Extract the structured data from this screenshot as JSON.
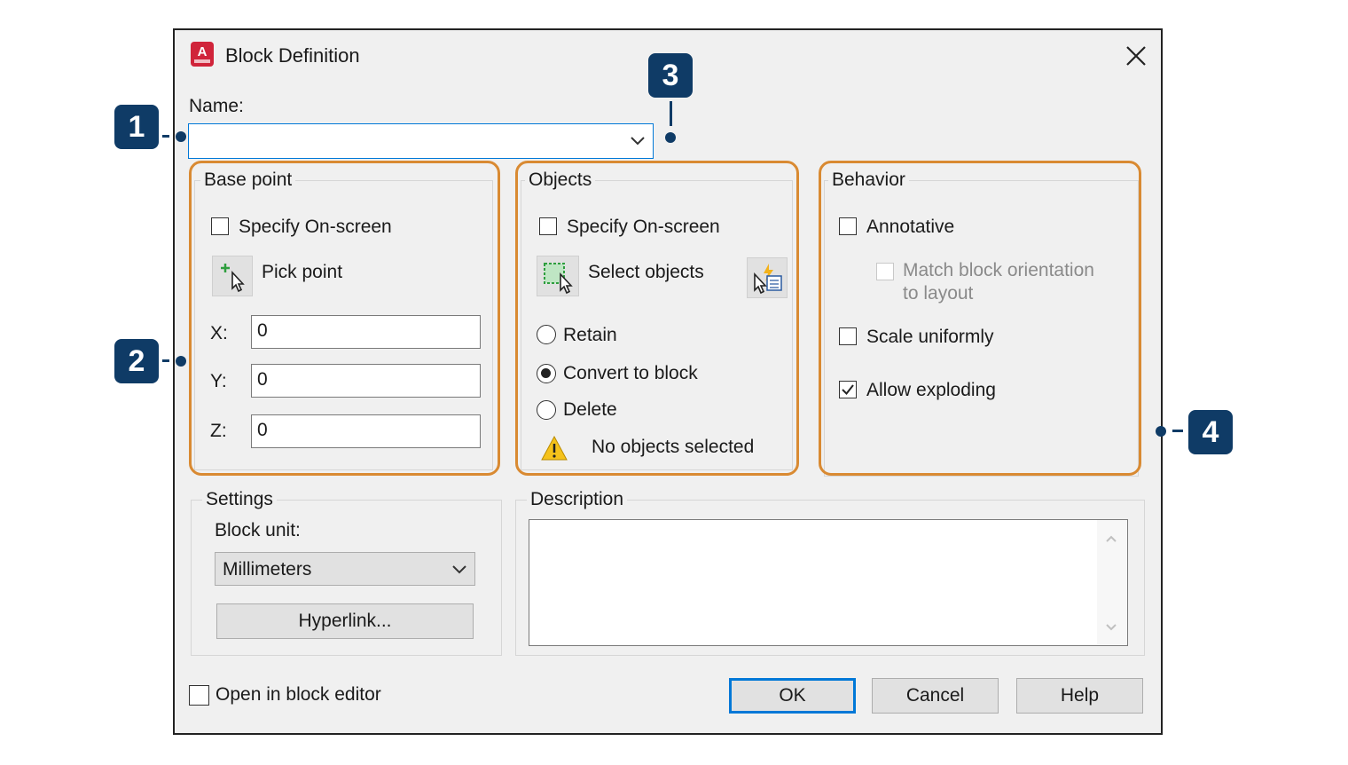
{
  "dialog": {
    "title": "Block Definition",
    "name_label": "Name:",
    "name_value": ""
  },
  "base_point": {
    "title": "Base point",
    "specify_on_screen": "Specify On-screen",
    "pick_point": "Pick point",
    "x_label": "X:",
    "y_label": "Y:",
    "z_label": "Z:",
    "x_value": "0",
    "y_value": "0",
    "z_value": "0"
  },
  "objects": {
    "title": "Objects",
    "specify_on_screen": "Specify On-screen",
    "select_objects": "Select objects",
    "retain": "Retain",
    "convert_to_block": "Convert to block",
    "delete": "Delete",
    "selected_option": "Convert to block",
    "status": "No objects selected"
  },
  "behavior": {
    "title": "Behavior",
    "annotative": "Annotative",
    "match_orientation_line1": "Match block orientation",
    "match_orientation_line2": "to layout",
    "scale_uniformly": "Scale uniformly",
    "allow_exploding": "Allow exploding",
    "allow_exploding_checked": true
  },
  "settings": {
    "title": "Settings",
    "block_unit_label": "Block unit:",
    "block_unit_value": "Millimeters",
    "hyperlink_button": "Hyperlink..."
  },
  "description": {
    "title": "Description",
    "value": ""
  },
  "footer": {
    "open_in_block_editor": "Open in block editor",
    "ok": "OK",
    "cancel": "Cancel",
    "help": "Help"
  },
  "callouts": [
    "1",
    "2",
    "3",
    "4"
  ],
  "colors": {
    "highlight": "#d98a32",
    "callout": "#0f3b66",
    "focus": "#0078d7",
    "app_icon": "#d0243a"
  },
  "icons": {
    "app": "autocad-app-icon",
    "close": "close-icon",
    "pick_point": "pick-point-icon",
    "select_objects": "select-objects-icon",
    "quick_select": "quick-select-icon",
    "warning": "warning-icon"
  }
}
